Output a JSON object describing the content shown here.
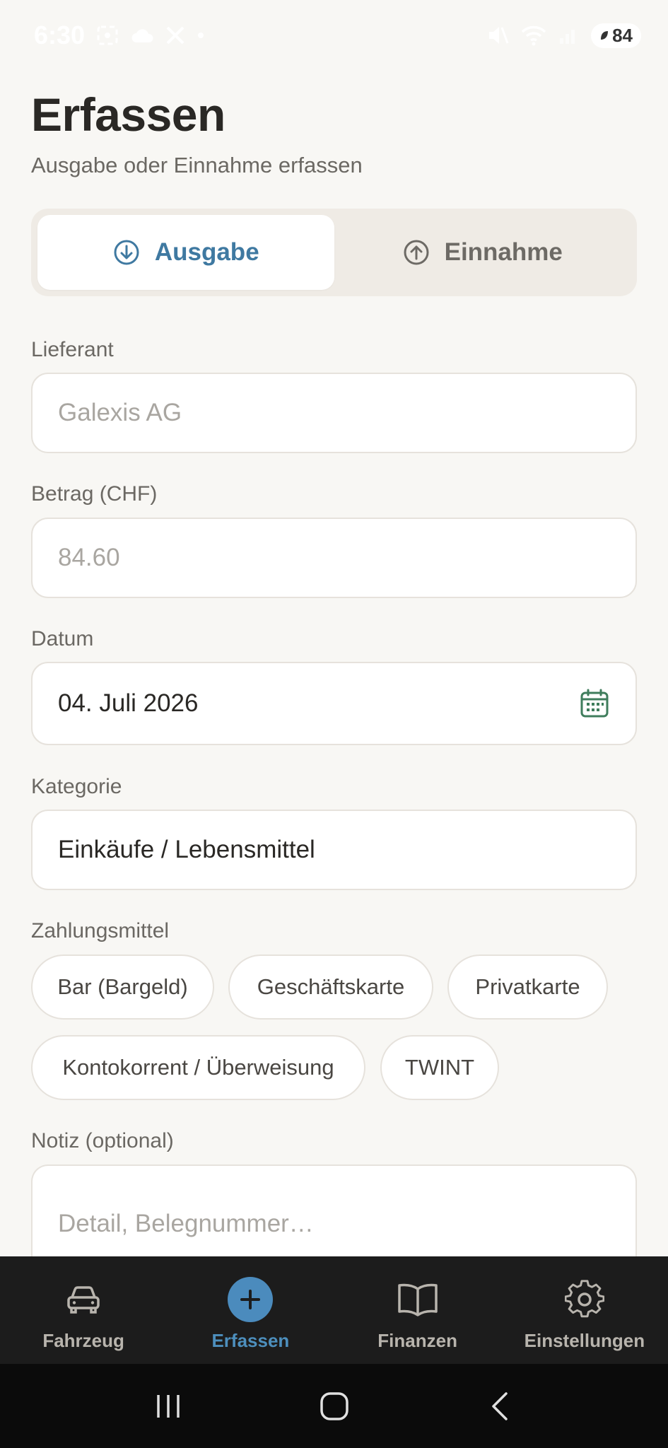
{
  "status_bar": {
    "time": "6:30",
    "battery": "84"
  },
  "header": {
    "title": "Erfassen",
    "subtitle": "Ausgabe oder Einnahme erfassen"
  },
  "type_toggle": {
    "options": [
      {
        "label": "Ausgabe",
        "icon": "arrow-down-circle-icon",
        "active": true
      },
      {
        "label": "Einnahme",
        "icon": "arrow-up-circle-icon",
        "active": false
      }
    ]
  },
  "form": {
    "supplier": {
      "label": "Lieferant",
      "placeholder": "Galexis AG",
      "value": ""
    },
    "amount": {
      "label": "Betrag (CHF)",
      "placeholder": "84.60",
      "value": ""
    },
    "date": {
      "label": "Datum",
      "value": "04. Juli 2026"
    },
    "category": {
      "label": "Kategorie",
      "value": "Einkäufe / Lebensmittel"
    },
    "payment": {
      "label": "Zahlungsmittel",
      "options": [
        "Bar (Bargeld)",
        "Geschäftskarte",
        "Privatkarte",
        "Kontokorrent / Überweisung",
        "TWINT"
      ]
    },
    "note": {
      "label": "Notiz (optional)",
      "placeholder": "Detail, Belegnummer…"
    }
  },
  "bottom_nav": {
    "items": [
      {
        "label": "Fahrzeug",
        "icon": "car-icon",
        "active": false
      },
      {
        "label": "Erfassen",
        "icon": "plus-icon",
        "active": true
      },
      {
        "label": "Finanzen",
        "icon": "book-icon",
        "active": false
      },
      {
        "label": "Einstellungen",
        "icon": "gear-icon",
        "active": false
      }
    ]
  },
  "colors": {
    "accent": "#3f79a1",
    "nav_active": "#4d8fbd",
    "background": "#f8f7f4",
    "calendar_icon": "#3f7d5c"
  }
}
